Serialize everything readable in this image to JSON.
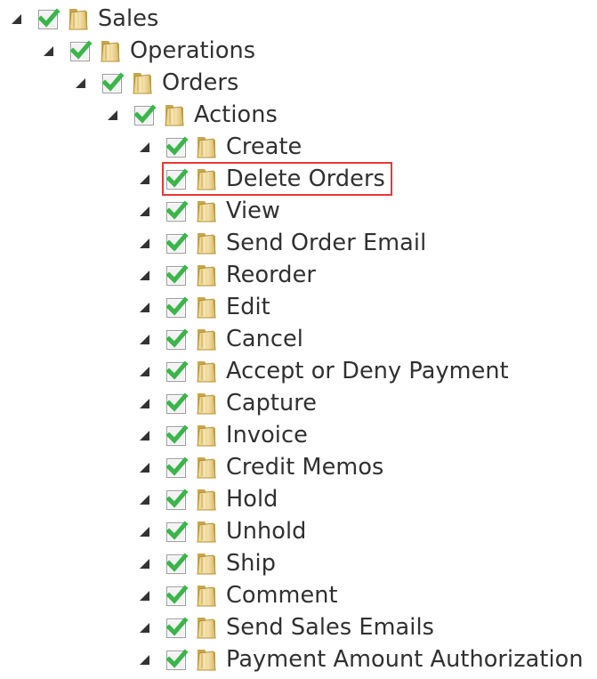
{
  "tree": {
    "toggle_icon": "expanded-triangle-icon",
    "checkbox_icon": "checked-checkbox-icon",
    "folder_icon": "folder-icon",
    "checked_color": "#3ab54a",
    "highlight_color": "#e53935",
    "highlighted_label": "Delete Orders",
    "nodes": [
      {
        "label": "Sales",
        "depth": 0,
        "checked": true
      },
      {
        "label": "Operations",
        "depth": 1,
        "checked": true
      },
      {
        "label": "Orders",
        "depth": 2,
        "checked": true
      },
      {
        "label": "Actions",
        "depth": 3,
        "checked": true
      },
      {
        "label": "Create",
        "depth": 4,
        "checked": true
      },
      {
        "label": "Delete Orders",
        "depth": 4,
        "checked": true
      },
      {
        "label": "View",
        "depth": 4,
        "checked": true
      },
      {
        "label": "Send Order Email",
        "depth": 4,
        "checked": true
      },
      {
        "label": "Reorder",
        "depth": 4,
        "checked": true
      },
      {
        "label": "Edit",
        "depth": 4,
        "checked": true
      },
      {
        "label": "Cancel",
        "depth": 4,
        "checked": true
      },
      {
        "label": "Accept or Deny Payment",
        "depth": 4,
        "checked": true
      },
      {
        "label": "Capture",
        "depth": 4,
        "checked": true
      },
      {
        "label": "Invoice",
        "depth": 4,
        "checked": true
      },
      {
        "label": "Credit Memos",
        "depth": 4,
        "checked": true
      },
      {
        "label": "Hold",
        "depth": 4,
        "checked": true
      },
      {
        "label": "Unhold",
        "depth": 4,
        "checked": true
      },
      {
        "label": "Ship",
        "depth": 4,
        "checked": true
      },
      {
        "label": "Comment",
        "depth": 4,
        "checked": true
      },
      {
        "label": "Send Sales Emails",
        "depth": 4,
        "checked": true
      },
      {
        "label": "Payment Amount Authorization",
        "depth": 4,
        "checked": true
      }
    ]
  }
}
